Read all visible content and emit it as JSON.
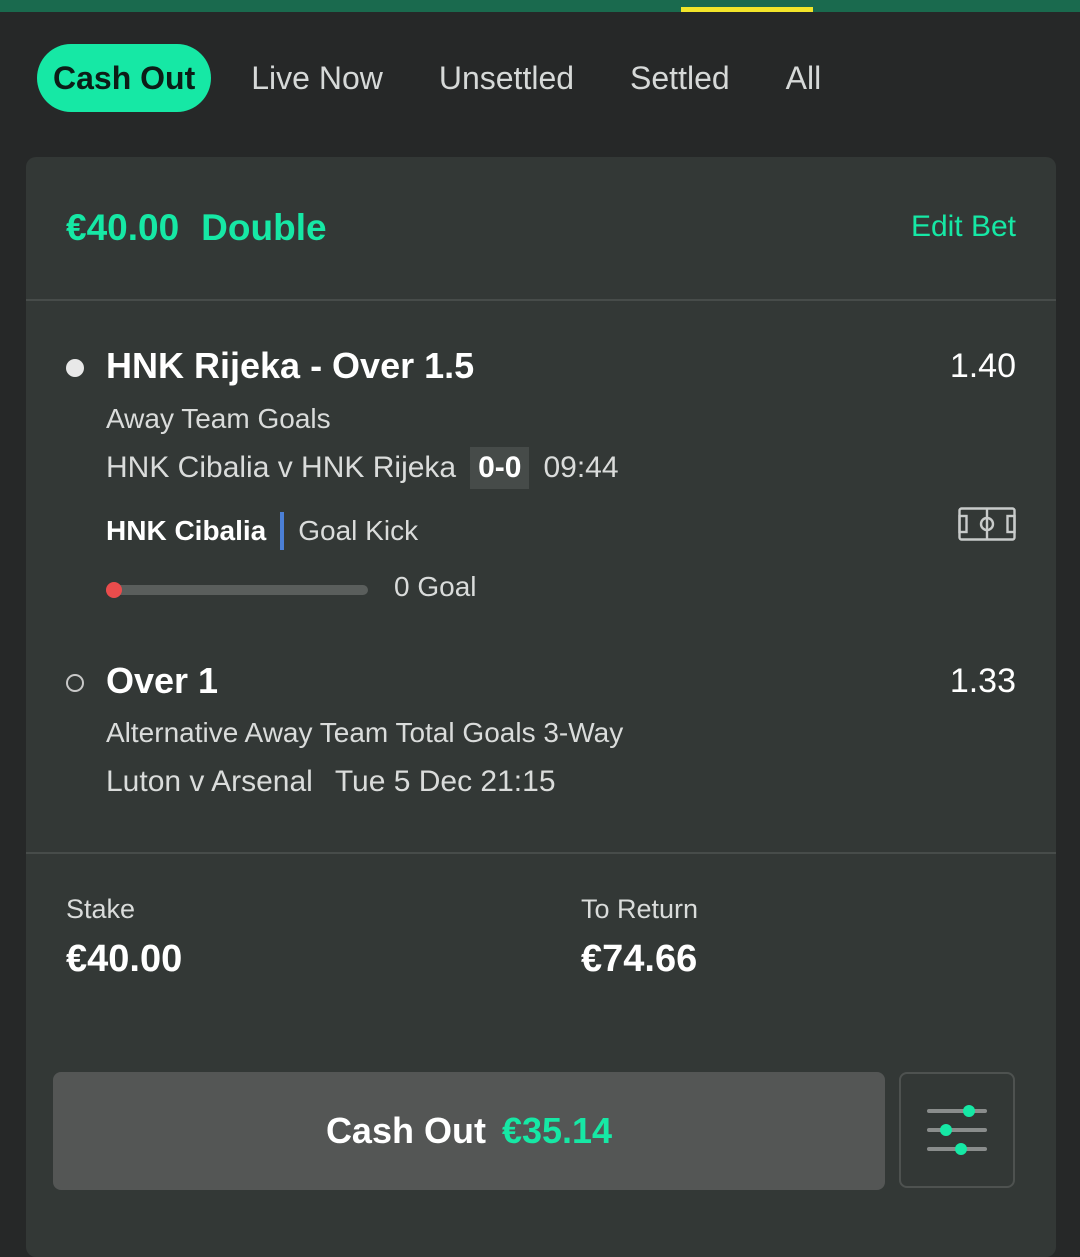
{
  "filter_tabs": [
    {
      "label": "Cash Out",
      "active": true
    },
    {
      "label": "Live Now",
      "active": false
    },
    {
      "label": "Unsettled",
      "active": false
    },
    {
      "label": "Settled",
      "active": false
    },
    {
      "label": "All",
      "active": false
    }
  ],
  "bet": {
    "stake_amount": "€40.00",
    "bet_type": "Double",
    "edit_label": "Edit Bet",
    "selections": [
      {
        "title": "HNK Rijeka - Over 1.5",
        "odds": "1.40",
        "market": "Away Team Goals",
        "event": "HNK Cibalia v HNK Rijeka",
        "score": "0-0",
        "clock": "09:44",
        "status": "live",
        "live_team": "HNK Cibalia",
        "live_event": "Goal Kick",
        "progress_label": "0 Goal",
        "progress_fraction": 0
      },
      {
        "title": "Over 1",
        "odds": "1.33",
        "market": "Alternative Away Team Total Goals 3-Way",
        "event": "Luton v Arsenal",
        "kickoff": "Tue 5 Dec 21:15",
        "status": "upcoming"
      }
    ],
    "stake_label": "Stake",
    "stake_value": "€40.00",
    "return_label": "To Return",
    "return_value": "€74.66",
    "cashout_label": "Cash Out",
    "cashout_amount": "€35.14"
  },
  "colors": {
    "accent": "#16e8a5",
    "background": "#262828",
    "card": "#333836",
    "live_indicator": "#ea4c4c",
    "divider_blue": "#4b7fd6",
    "header_strip": "#1a6a4e",
    "header_strip_active": "#f2e52a"
  },
  "icons": {
    "pitch": "pitch-icon",
    "settings": "sliders-icon"
  }
}
